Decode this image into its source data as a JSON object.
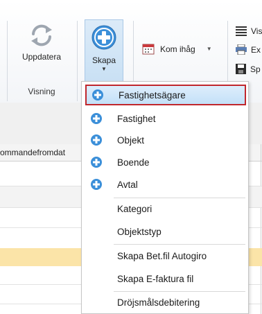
{
  "ribbon": {
    "uppdatera_label": "Uppdatera",
    "visning_group_label": "Visning",
    "skapa_label": "Skapa",
    "kom_ihag_label": "Kom ihåg",
    "right_items": [
      "Vis",
      "Ex",
      "Sp"
    ]
  },
  "grid": {
    "column_header": "Kommandefromdat"
  },
  "menu": {
    "items": [
      {
        "label": "Fastighetsägare",
        "icon": "plus-circle-icon"
      },
      {
        "label": "Fastighet",
        "icon": "plus-circle-icon"
      },
      {
        "label": "Objekt",
        "icon": "plus-circle-icon"
      },
      {
        "label": "Boende",
        "icon": "plus-circle-icon"
      },
      {
        "label": "Avtal",
        "icon": "plus-circle-icon"
      },
      {
        "label": "Kategori"
      },
      {
        "label": "Objektstyp"
      },
      {
        "label": "Skapa Bet.fil Autogiro"
      },
      {
        "label": "Skapa E-faktura fil"
      },
      {
        "label": "Dröjsmålsdebitering"
      }
    ]
  },
  "colors": {
    "accent_blue": "#3b8fd9",
    "selection_border": "#c0262c",
    "row_highlight": "#fbe4a8"
  }
}
